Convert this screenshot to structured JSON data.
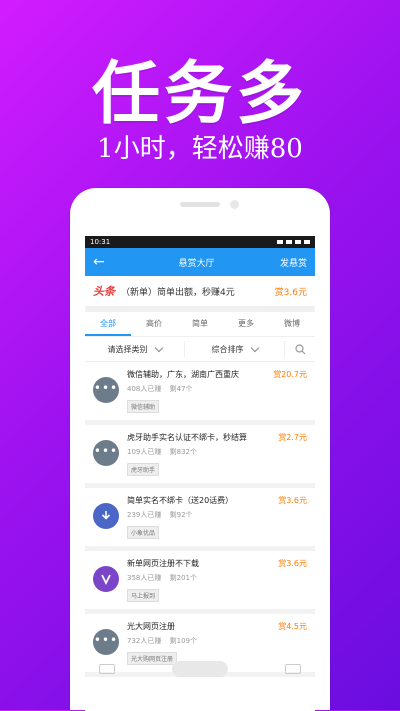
{
  "promo": {
    "title": "任务多",
    "subtitle": "1小时，轻松赚80"
  },
  "status_bar": {
    "time": "10:31"
  },
  "header": {
    "title": "悬赏大厅",
    "action": "发悬赏"
  },
  "banner": {
    "brand": "头条",
    "text": "（新单）简单出额，秒赚4元",
    "reward": "赏3.6元"
  },
  "tabs": [
    "全部",
    "高价",
    "简单",
    "更多",
    "微博"
  ],
  "filters": {
    "category": "请选择类别",
    "sort": "综合排序"
  },
  "tasks": [
    {
      "title": "微信辅助，广东，湖南广西重庆",
      "done": "408人已赚",
      "left": "剩47个",
      "tag": "微信辅助",
      "reward": "赏20.7元",
      "icon": "more-icon",
      "color": "#6d7c8a"
    },
    {
      "title": "虎牙助手实名认证不绑卡，秒结算",
      "done": "109人已赚",
      "left": "剩832个",
      "tag": "虎牙助手",
      "reward": "赏2.7元",
      "icon": "more-icon",
      "color": "#6d7c8a"
    },
    {
      "title": "简单实名不绑卡（送20话费）",
      "done": "239人已赚",
      "left": "剩92个",
      "tag": "小象优品",
      "reward": "赏3.6元",
      "icon": "download-icon",
      "color": "#4a67c8"
    },
    {
      "title": "新单网页注册不下载",
      "done": "358人已赚",
      "left": "剩201个",
      "tag": "马上报到",
      "reward": "赏3.6元",
      "icon": "v-badge-icon",
      "color": "#7b45c9"
    },
    {
      "title": "光大网页注册",
      "done": "732人已赚",
      "left": "剩109个",
      "tag": "光大购网页注册",
      "reward": "赏4.5元",
      "icon": "more-icon",
      "color": "#6d7c8a"
    }
  ]
}
